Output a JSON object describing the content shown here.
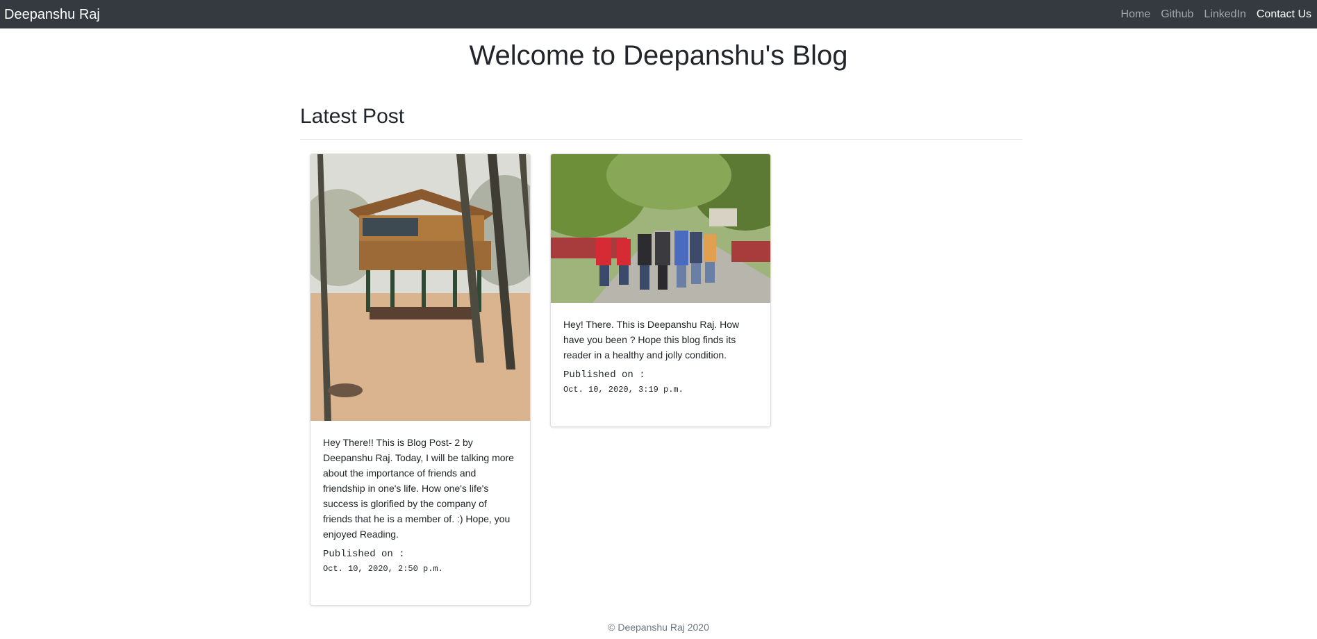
{
  "navbar": {
    "brand": "Deepanshu Raj",
    "links": [
      {
        "label": "Home"
      },
      {
        "label": "Github"
      },
      {
        "label": "LinkedIn"
      },
      {
        "label": "Contact Us"
      }
    ]
  },
  "main": {
    "title": "Welcome to Deepanshu's Blog",
    "section_heading": "Latest Post",
    "posts": [
      {
        "image_icon": "treehouse-photo",
        "text": "Hey There!! This is Blog Post- 2 by Deepanshu Raj. Today, I will be talking more about the importance of friends and friendship in one's life. How one's life's success is glorified by the company of friends that he is a member of. :) Hope, you enjoyed Reading.",
        "published_label": "Published on :",
        "published_date": "Oct. 10, 2020, 2:50 p.m."
      },
      {
        "image_icon": "friends-walking-photo",
        "text": "Hey! There. This is Deepanshu Raj. How have you been ? Hope this blog finds its reader in a healthy and jolly condition.",
        "published_label": "Published on :",
        "published_date": "Oct. 10, 2020, 3:19 p.m."
      }
    ]
  },
  "footer": {
    "text": "© Deepanshu Raj 2020"
  }
}
